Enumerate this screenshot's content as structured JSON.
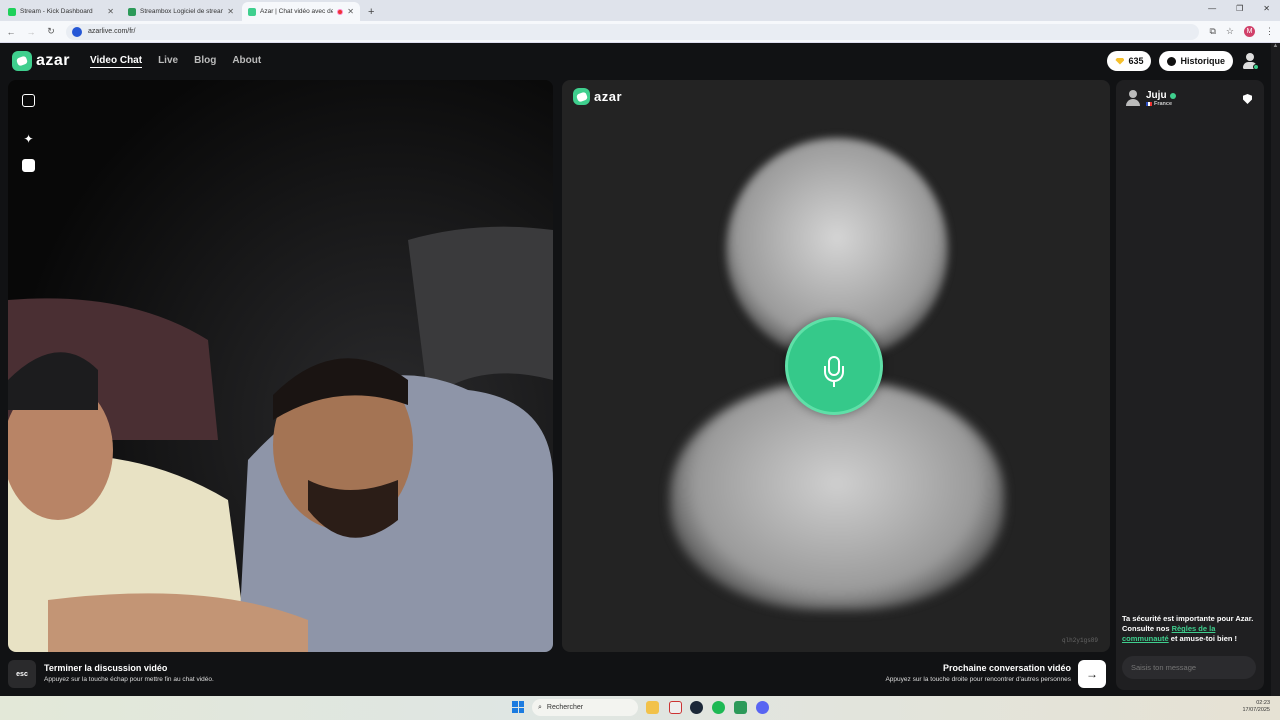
{
  "browser": {
    "tabs": [
      {
        "label": "Stream - Kick Dashboard",
        "favicon_color": "#1fd15a",
        "active": false
      },
      {
        "label": "Streambox Logiciel de stream",
        "favicon_color": "#2c9a59",
        "active": false
      },
      {
        "label": "Azar | Chat vidéo avec de n",
        "favicon_color": "#3fcf8e",
        "active": true,
        "recording": true
      }
    ],
    "new_tab": "+",
    "url": "azarlive.com/fr/",
    "profile_initial": "M"
  },
  "site": {
    "brand": "azar",
    "nav": [
      {
        "label": "Video Chat",
        "active": true
      },
      {
        "label": "Live",
        "active": false
      },
      {
        "label": "Blog",
        "active": false
      },
      {
        "label": "About",
        "active": false
      }
    ],
    "gems": "635",
    "history_label": "Historique",
    "accent": "#3fcf8e"
  },
  "remote": {
    "brand": "azar",
    "watermark": "qlh2y1gs89"
  },
  "chat": {
    "peer_name": "Juju",
    "peer_country": "France",
    "safety_before": "Ta sécurité est importante pour Azar. Consulte nos ",
    "safety_link": "Règles de la communauté",
    "safety_after": " et amuse-toi bien !",
    "message_placeholder": "Saisis ton message"
  },
  "footer": {
    "esc_key": "esc",
    "end_title": "Terminer la discussion vidéo",
    "end_sub": "Appuyez sur la touche échap pour mettre fin au chat vidéo.",
    "next_title": "Prochaine conversation vidéo",
    "next_sub": "Appuyez sur la touche droite pour rencontrer d'autres personnes",
    "next_arrow": "→"
  },
  "taskbar": {
    "search_placeholder": "Rechercher",
    "time": "02:23",
    "date": "17/07/2025"
  }
}
